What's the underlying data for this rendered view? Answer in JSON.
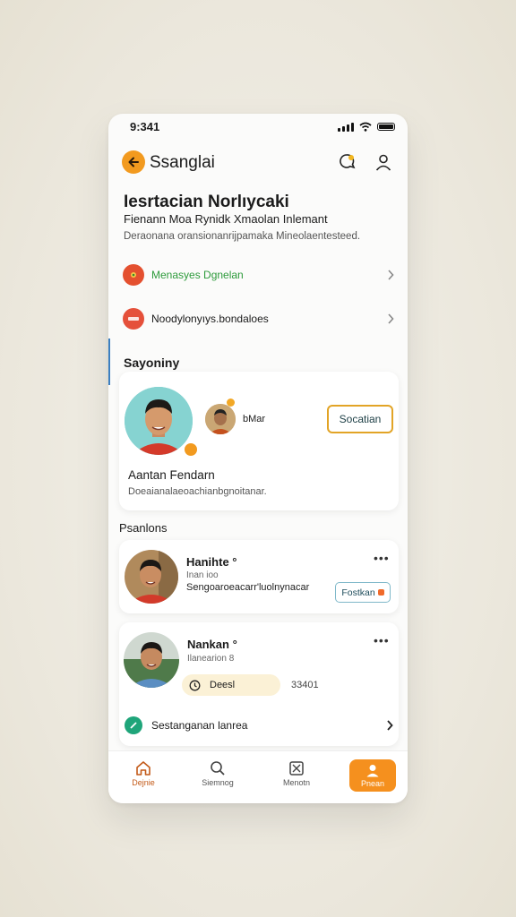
{
  "status_bar": {
    "time": "9:341"
  },
  "header": {
    "title": "Ssanglai"
  },
  "hero": {
    "title": "Iesrtacian Norlıycaki",
    "subtitle": "Fienann Moa Rynidk Xmaolan Inlemant",
    "description": "Deraonana oransionanrijpamaka Mineolaentesteed."
  },
  "links": [
    {
      "label": "Menasyes Dgnelan",
      "color": "#2c9a3a",
      "icon": "flower-icon"
    },
    {
      "label": "Noodylonyıys.bondaloes",
      "color": "#1b1b1b",
      "icon": "badge-icon"
    }
  ],
  "section_one": {
    "title": "Sayoniny"
  },
  "featured": {
    "small_label": "bMar",
    "button": "Socatian",
    "name": "Aantan Fendarn",
    "description": "Doeaianalaeoachianbgnoitanar."
  },
  "section_two": {
    "title": "Psanlons"
  },
  "people": [
    {
      "name": "Hanihte °",
      "meta": "Inan ioo",
      "text": "Sengoaroeacarr'luolnynacar",
      "button": "Fostkan"
    },
    {
      "name": "Nankan °",
      "meta": "Ilanearion 8",
      "pill": "Deesl",
      "pill_value": "33401",
      "link": "Sestanganan lanrea"
    }
  ],
  "bottom_nav": [
    {
      "label": "Dejnie"
    },
    {
      "label": "Siemnog"
    },
    {
      "label": "Menotn"
    },
    {
      "label": "Pnean"
    }
  ],
  "colors": {
    "accent": "#f29a1f",
    "link_green": "#2c9a3a",
    "outline": "#e2a426"
  }
}
